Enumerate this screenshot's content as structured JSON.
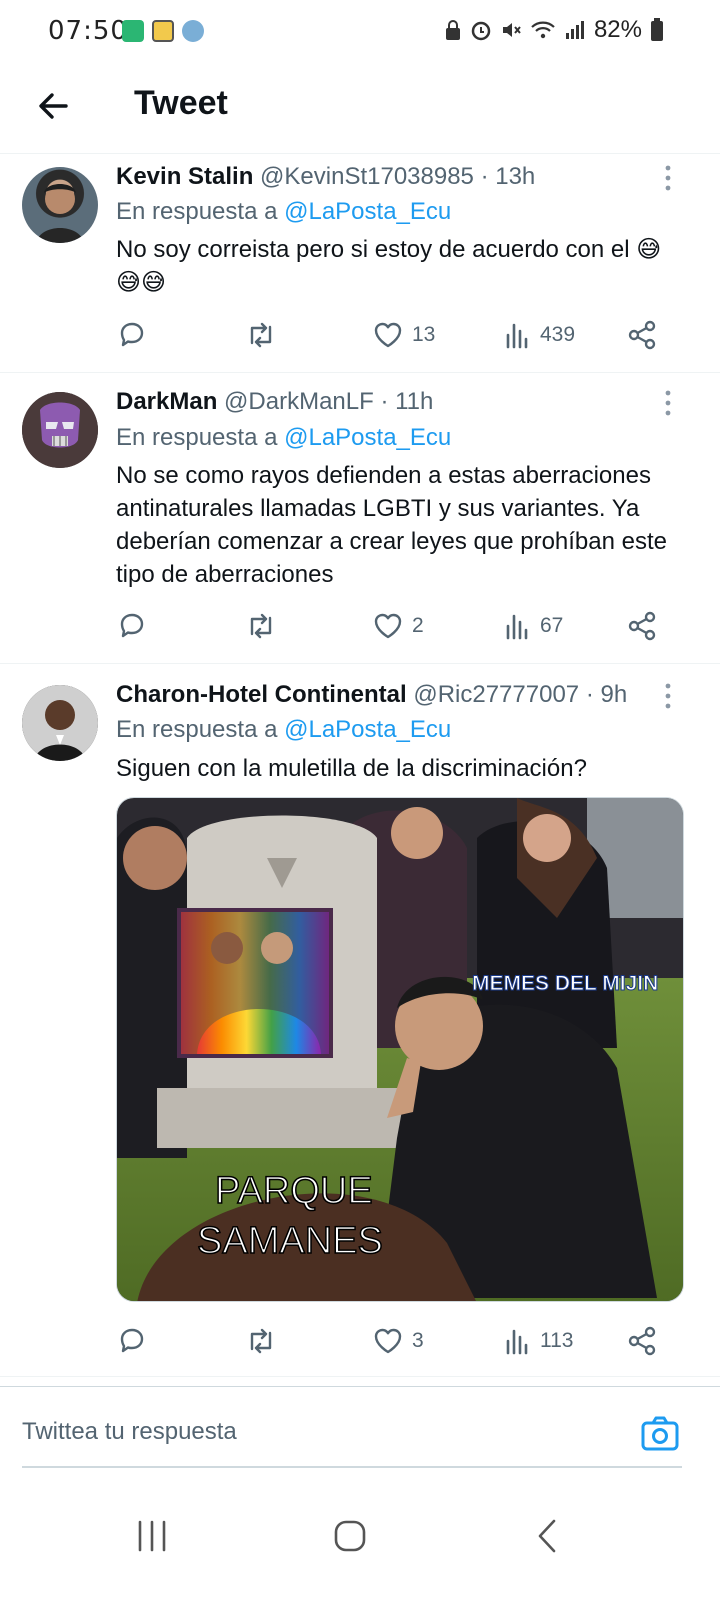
{
  "status_bar": {
    "time": "07:50",
    "battery": "82%",
    "left_icons": [
      "app-notification-icon",
      "save-icon",
      "drone-icon"
    ],
    "right_icons": [
      "lock-icon",
      "alarm-icon",
      "mute-icon",
      "wifi-icon",
      "signal-icon",
      "battery-icon"
    ]
  },
  "header": {
    "title": "Tweet",
    "back_icon": "arrow-left-icon"
  },
  "tweets": [
    {
      "name": "Kevin Stalin",
      "handle": "@KevinSt17038985",
      "time": "· 13h",
      "reply_prefix": "En respuesta a",
      "reply_to": "@LaPosta_Ecu",
      "text": "No soy correista pero si estoy de acuerdo con el 😅😅😅",
      "likes": "13",
      "views": "439"
    },
    {
      "name": "DarkMan",
      "handle": "@DarkManLF",
      "time": "· 11h",
      "reply_prefix": "En respuesta a",
      "reply_to": "@LaPosta_Ecu",
      "text": "No se como rayos defienden a estas aberraciones antinaturales llamadas LGBTI y sus variantes. Ya deberían comenzar a crear leyes que prohíban este tipo de aberraciones",
      "likes": "2",
      "views": "67"
    },
    {
      "name": "Charon-Hotel Continental",
      "handle": "@Ric27777007",
      "time": "· 9h",
      "reply_prefix": "En respuesta a",
      "reply_to": "@LaPosta_Ecu",
      "text": "Siguen con la muletilla de la discriminación?",
      "likes": "3",
      "views": "113",
      "media": {
        "watermark": "MEMES DEL MIJIN",
        "caption": "PARQUE SAMANES"
      }
    }
  ],
  "composer": {
    "placeholder": "Twittea tu respuesta"
  },
  "colors": {
    "accent": "#1d9bf0",
    "text": "#0f1419",
    "muted": "#536471"
  }
}
